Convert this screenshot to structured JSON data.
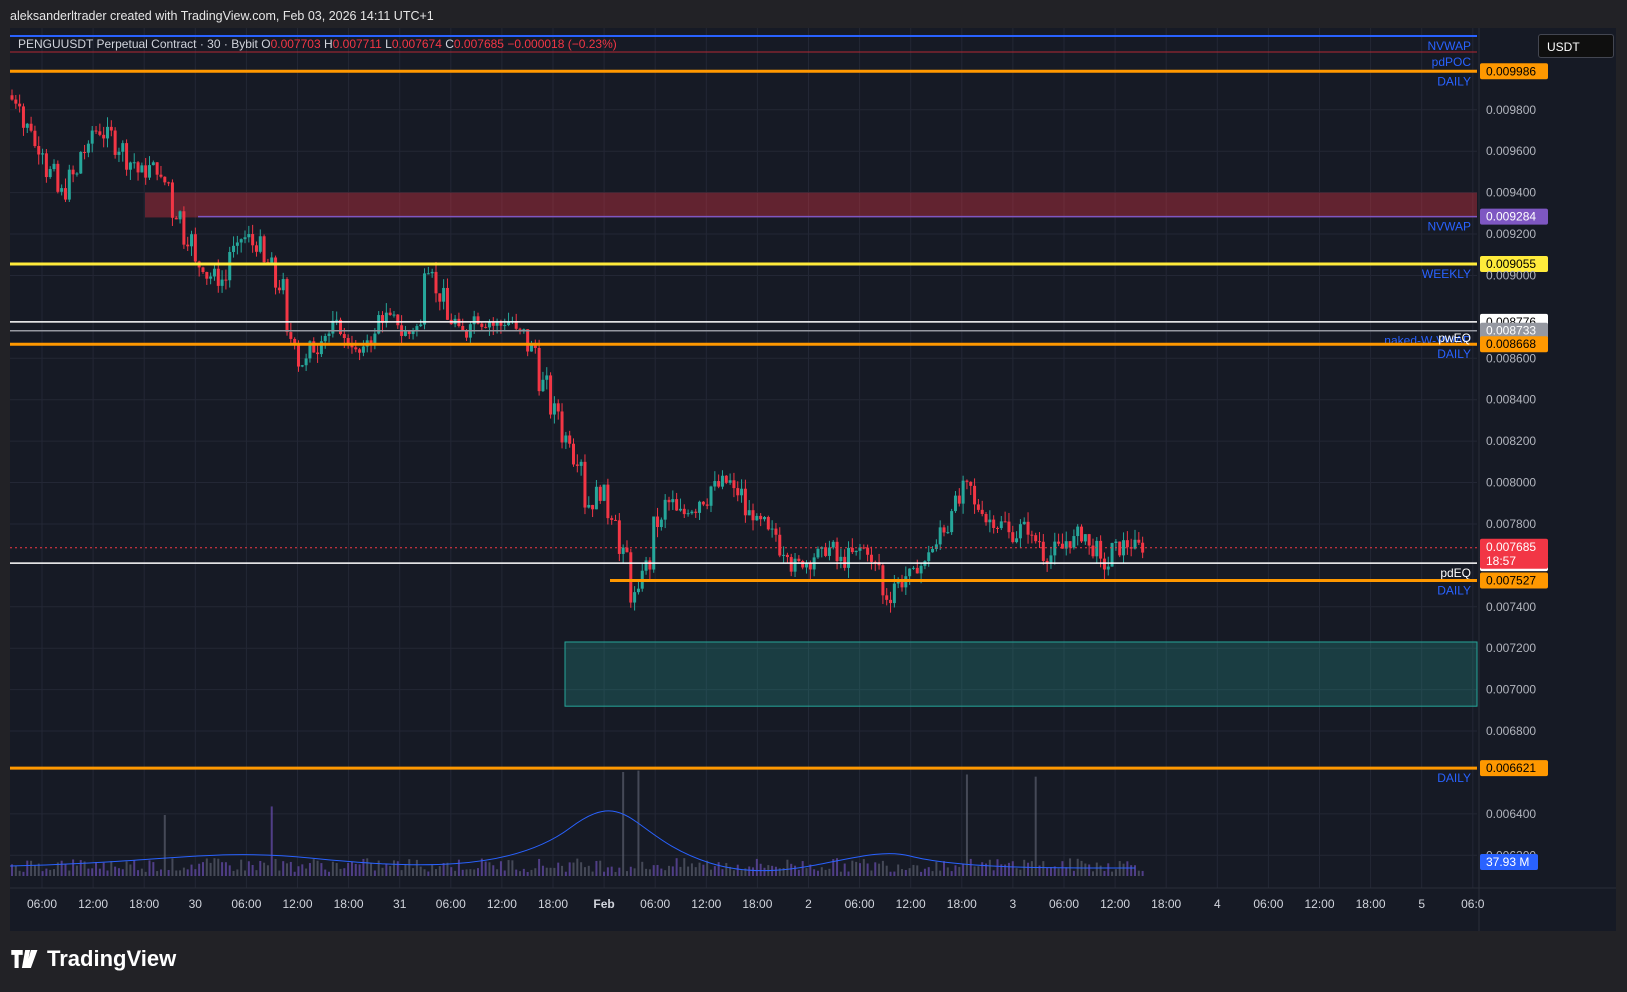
{
  "header": {
    "watermark": "aleksanderltrader created with TradingView.com, Feb 03, 2026 14:11 UTC+1"
  },
  "legend": {
    "symbol": "PENGUUSDT Perpetual Contract · 30 · Bybit",
    "o_label": "O",
    "o_value": "0.007703",
    "h_label": "H",
    "h_value": "0.007711",
    "l_label": "L",
    "l_value": "0.007674",
    "c_label": "C",
    "c_value": "0.007685",
    "change": "−0.000018 (−0.23%)"
  },
  "currency": "USDT",
  "logo_text": "TradingView",
  "colors": {
    "background": "#161a25",
    "up": "#26a69a",
    "down": "#f23645",
    "orange": "#ff9800",
    "yellow": "#ffeb3b",
    "blue_line": "#2962ff",
    "purple": "#7e57c2",
    "volume_ma": "#2962ff"
  },
  "chart_data": {
    "type": "candlestick",
    "symbol": "PENGUUSDT",
    "timeframe": "30",
    "ylim": [
      0.0061,
      0.01005
    ],
    "y_ticks": [
      "0.006200",
      "0.006400",
      "0.006800",
      "0.007000",
      "0.007200",
      "0.007400",
      "0.007800",
      "0.008000",
      "0.008200",
      "0.008400",
      "0.008600",
      "0.009000",
      "0.009200",
      "0.009400",
      "0.009600",
      "0.009800"
    ],
    "x_ticks": [
      "06:00",
      "12:00",
      "18:00",
      "30",
      "06:00",
      "12:00",
      "18:00",
      "31",
      "06:00",
      "12:00",
      "18:00",
      "Feb",
      "06:00",
      "12:00",
      "18:00",
      "2",
      "06:00",
      "12:00",
      "18:00",
      "3",
      "06:00",
      "12:00",
      "18:00",
      "4",
      "06:00",
      "12:00",
      "18:00",
      "5",
      "06:0"
    ],
    "candles_path_close": [
      0.00985,
      0.00972,
      0.00962,
      0.0095,
      0.0094,
      0.00948,
      0.0096,
      0.0097,
      0.00968,
      0.00962,
      0.00955,
      0.0095,
      0.00952,
      0.00945,
      0.0093,
      0.00918,
      0.00905,
      0.009,
      0.00898,
      0.00912,
      0.00918,
      0.00915,
      0.00905,
      0.00895,
      0.0087,
      0.00858,
      0.00865,
      0.00872,
      0.00875,
      0.00868,
      0.00862,
      0.0087,
      0.0088,
      0.00878,
      0.00872,
      0.00875,
      0.00905,
      0.0089,
      0.00878,
      0.00872,
      0.0088,
      0.00878,
      0.00876,
      0.00878,
      0.00872,
      0.00865,
      0.00848,
      0.00835,
      0.00822,
      0.00812,
      0.0079,
      0.00795,
      0.00785,
      0.00765,
      0.00745,
      0.0076,
      0.0078,
      0.0079,
      0.00785,
      0.00788,
      0.00792,
      0.00798,
      0.008,
      0.00795,
      0.00785,
      0.0078,
      0.00775,
      0.00768,
      0.0076,
      0.00762,
      0.00765,
      0.00768,
      0.00762,
      0.00765,
      0.00768,
      0.0076,
      0.00745,
      0.00752,
      0.00755,
      0.0076,
      0.00768,
      0.00778,
      0.0079,
      0.00797,
      0.00788,
      0.00782,
      0.0078,
      0.00775,
      0.00778,
      0.00772,
      0.00765,
      0.00768,
      0.00772,
      0.00775,
      0.00768,
      0.0076,
      0.00768,
      0.0077,
      0.00769
    ],
    "last_price": "0.007685",
    "countdown": "18:57",
    "price_lines": [
      {
        "price": 0.009986,
        "label": "DAILY",
        "tag": "0.009986",
        "color": "#ff9800"
      },
      {
        "price": 0.009284,
        "label": "NVWAP",
        "tag": "0.009284",
        "color": "#7e57c2"
      },
      {
        "price": 0.009055,
        "label": "WEEKLY",
        "tag": "0.009055",
        "color": "#ffeb3b"
      },
      {
        "price": 0.008776,
        "label": "",
        "tag": "0.008776",
        "color": "#ffffff"
      },
      {
        "price": 0.008733,
        "label": "naked-W-VWAP",
        "tag": "0.008733",
        "color": "#9598a1"
      },
      {
        "price": 0.008668,
        "label": "DAILY",
        "tag": "0.008668",
        "color": "#ff9800"
      },
      {
        "price": 0.007611,
        "label": "pdEQ",
        "tag": "0.007611",
        "color": "#ffffff"
      },
      {
        "price": 0.007527,
        "label": "DAILY",
        "tag": "0.007527",
        "color": "#ff9800"
      },
      {
        "price": 0.006621,
        "label": "DAILY",
        "tag": "0.006621",
        "color": "#ff9800"
      }
    ],
    "top_labels": [
      "NVWAP",
      "pdPOC"
    ],
    "pw_label": "pwEQ",
    "zones": [
      {
        "top": 0.0094,
        "bottom": 0.00928,
        "color": "#f23645"
      },
      {
        "top": 0.00723,
        "bottom": 0.00692,
        "color": "#26a69a"
      }
    ],
    "volume_label": "37.93 M"
  }
}
